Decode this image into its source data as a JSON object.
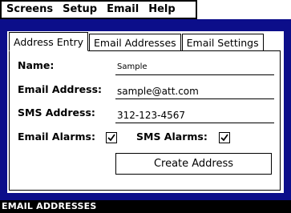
{
  "menu": {
    "items": [
      {
        "label": "Screens"
      },
      {
        "label": "Setup"
      },
      {
        "label": "Email"
      },
      {
        "label": "Help"
      }
    ]
  },
  "tabs": [
    {
      "label": "Address Entry",
      "active": true
    },
    {
      "label": "Email Addresses",
      "active": false
    },
    {
      "label": "Email Settings",
      "active": false
    }
  ],
  "form": {
    "name_label": "Name:",
    "name_value": "Sample",
    "email_label": "Email Address:",
    "email_value": "sample@att.com",
    "sms_label": "SMS Address:",
    "sms_value": "312-123-4567",
    "email_alarms_label": "Email Alarms:",
    "email_alarms_checked": true,
    "sms_alarms_label": "SMS Alarms:",
    "sms_alarms_checked": true,
    "create_button_label": "Create Address"
  },
  "status_bar": {
    "text": "EMAIL ADDRESSES"
  },
  "colors": {
    "panel_background": "#0c0e8a",
    "status_background": "#000000"
  }
}
